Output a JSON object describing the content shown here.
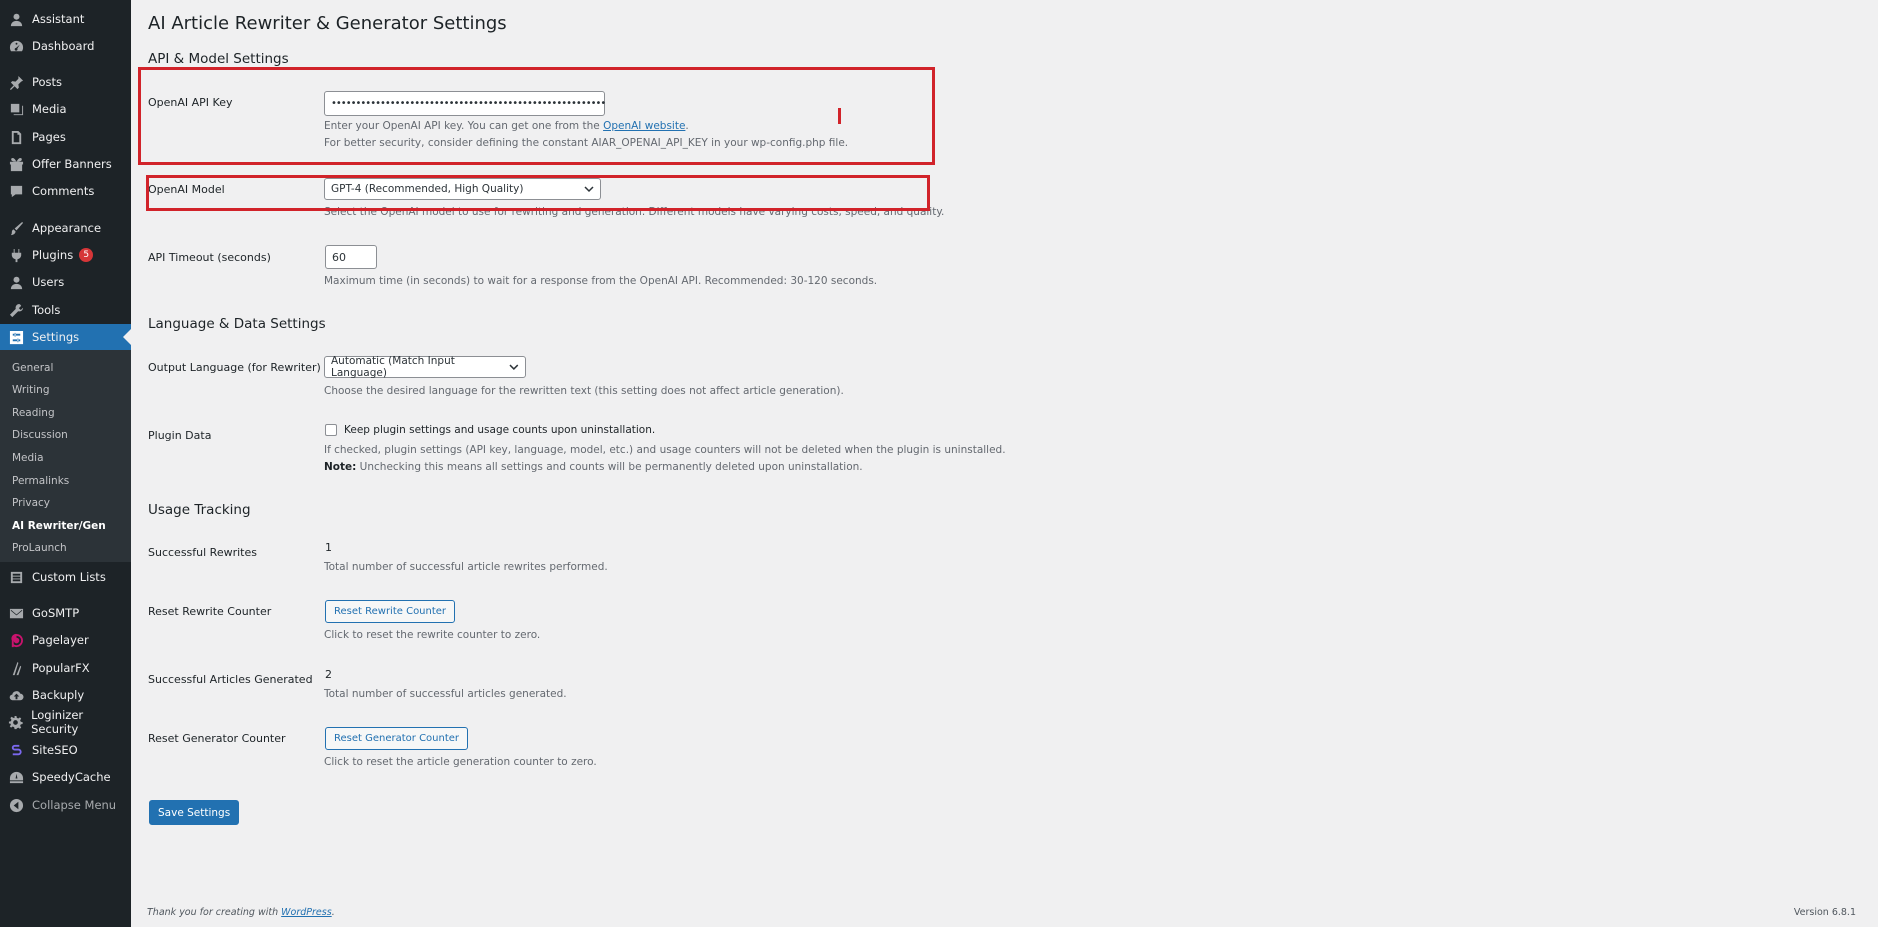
{
  "sidebar": {
    "items": [
      {
        "label": "Assistant",
        "icon": "user-icon"
      },
      {
        "label": "Dashboard",
        "icon": "dashboard-icon"
      },
      {
        "label": "Posts",
        "icon": "pin-icon"
      },
      {
        "label": "Media",
        "icon": "media-icon"
      },
      {
        "label": "Pages",
        "icon": "page-icon"
      },
      {
        "label": "Offer Banners",
        "icon": "gift-icon"
      },
      {
        "label": "Comments",
        "icon": "comment-icon"
      },
      {
        "label": "Appearance",
        "icon": "brush-icon"
      },
      {
        "label": "Plugins",
        "icon": "plug-icon",
        "badge": "5"
      },
      {
        "label": "Users",
        "icon": "user-icon"
      },
      {
        "label": "Tools",
        "icon": "wrench-icon"
      },
      {
        "label": "Settings",
        "icon": "settings-icon"
      }
    ],
    "submenu": [
      "General",
      "Writing",
      "Reading",
      "Discussion",
      "Media",
      "Permalinks",
      "Privacy",
      "AI Rewriter/Gen",
      "ProLaunch"
    ],
    "items2": [
      {
        "label": "Custom Lists",
        "icon": "list-icon"
      },
      {
        "label": "GoSMTP",
        "icon": "mail-icon"
      },
      {
        "label": "Pagelayer",
        "icon": "pagelayer-icon"
      },
      {
        "label": "PopularFX",
        "icon": "popularfx-icon"
      },
      {
        "label": "Backuply",
        "icon": "cloud-icon"
      },
      {
        "label": "Loginizer Security",
        "icon": "gear-icon"
      },
      {
        "label": "SiteSEO",
        "icon": "siteseo-icon"
      },
      {
        "label": "SpeedyCache",
        "icon": "speedycache-icon"
      }
    ],
    "collapse_label": "Collapse Menu"
  },
  "page": {
    "title": "AI Article Rewriter & Generator Settings",
    "section_api": "API & Model Settings",
    "api_key_label": "OpenAI API Key",
    "api_key_value": "••••••••••••••••••••••••••••••••••••••••••••••••••••••••",
    "api_key_desc_pre": "Enter your OpenAI API key. You can get one from the ",
    "api_key_desc_link": "OpenAI website",
    "api_key_desc_post": ".",
    "api_key_desc2": "For better security, consider defining the constant AIAR_OPENAI_API_KEY in your wp-config.php file.",
    "model_label": "OpenAI Model",
    "model_value": "GPT-4 (Recommended, High Quality)",
    "model_desc": "Select the OpenAI model to use for rewriting and generation. Different models have varying costs, speed, and quality.",
    "timeout_label": "API Timeout (seconds)",
    "timeout_value": "60",
    "timeout_desc": "Maximum time (in seconds) to wait for a response from the OpenAI API. Recommended: 30-120 seconds.",
    "section_lang": "Language & Data Settings",
    "lang_label": "Output Language (for Rewriter)",
    "lang_value": "Automatic (Match Input Language)",
    "lang_desc": "Choose the desired language for the rewritten text (this setting does not affect article generation).",
    "plugin_data_label": "Plugin Data",
    "plugin_data_checkbox_label": "Keep plugin settings and usage counts upon uninstallation.",
    "plugin_data_desc": "If checked, plugin settings (API key, language, model, etc.) and usage counters will not be deleted when the plugin is uninstalled.",
    "plugin_data_note_strong": "Note:",
    "plugin_data_note": " Unchecking this means all settings and counts will be permanently deleted upon uninstallation.",
    "section_usage": "Usage Tracking",
    "rewrites_label": "Successful Rewrites",
    "rewrites_value": "1",
    "rewrites_desc": "Total number of successful article rewrites performed.",
    "reset_rewrite_label": "Reset Rewrite Counter",
    "reset_rewrite_button": "Reset Rewrite Counter",
    "reset_rewrite_desc": "Click to reset the rewrite counter to zero.",
    "generated_label": "Successful Articles Generated",
    "generated_value": "2",
    "generated_desc": "Total number of successful articles generated.",
    "reset_generator_label": "Reset Generator Counter",
    "reset_generator_button": "Reset Generator Counter",
    "reset_generator_desc": "Click to reset the article generation counter to zero.",
    "save_button": "Save Settings"
  },
  "footer": {
    "thanks_pre": "Thank you for creating with ",
    "thanks_link": "WordPress",
    "thanks_post": ".",
    "version": "Version 6.8.1"
  },
  "colors": {
    "highlight": "#d1232a",
    "accent": "#2271b1",
    "sidebar": "#1d2327"
  }
}
